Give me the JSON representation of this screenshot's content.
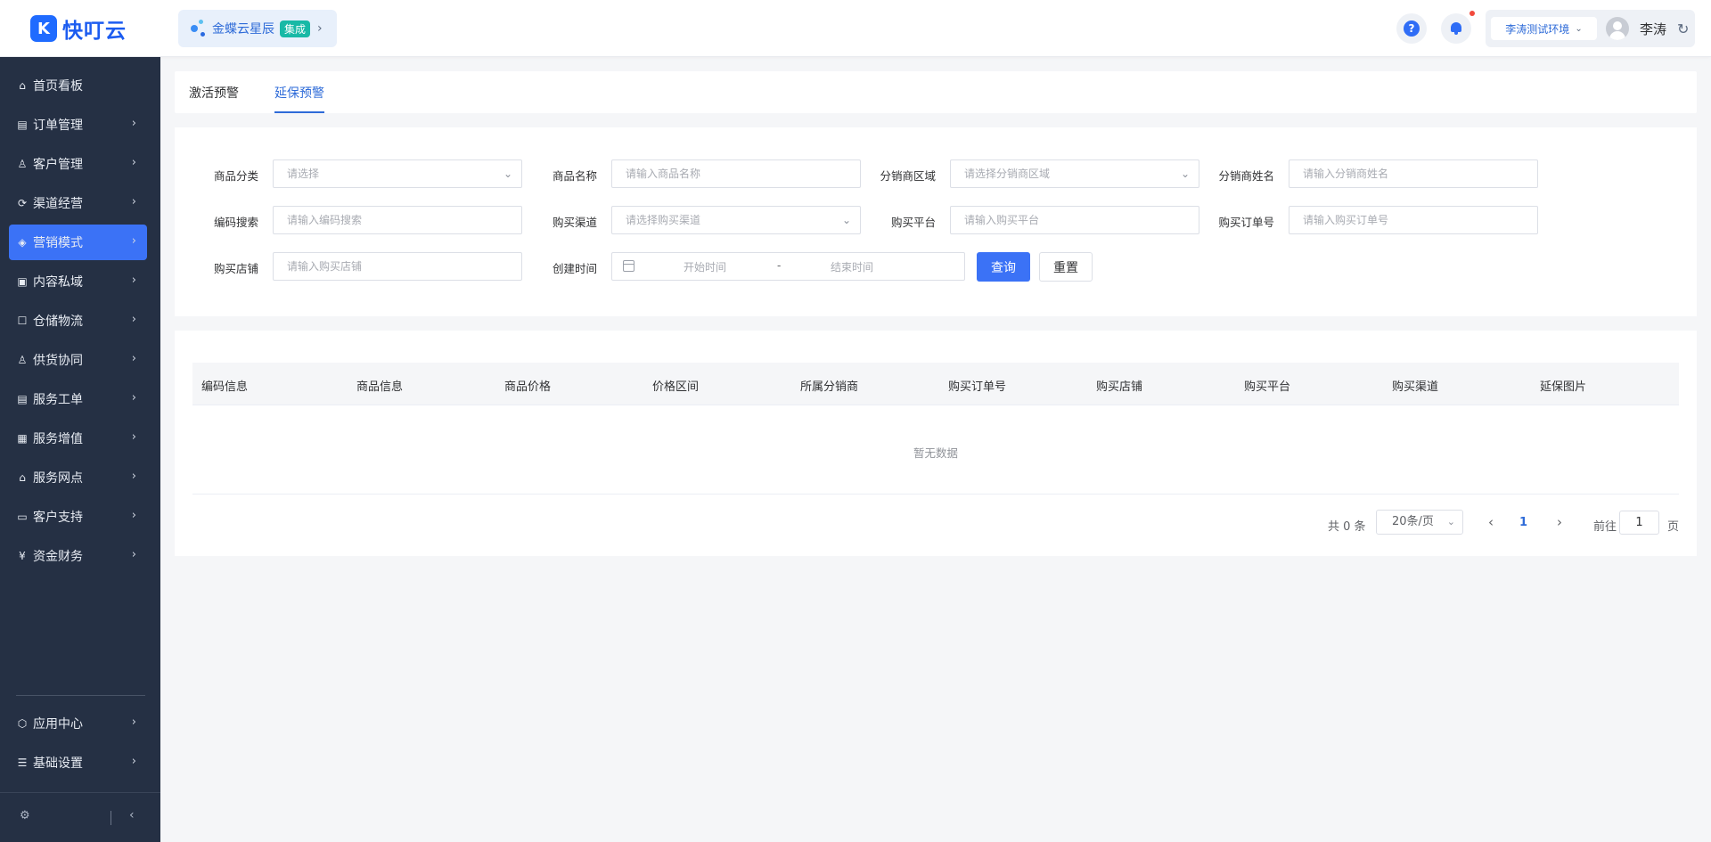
{
  "header": {
    "logo_text": "快叮云",
    "logo_mark": "K",
    "biz_name": "金蝶云星辰",
    "biz_badge": "集成",
    "help_label": "?",
    "env": "李涛测试环境",
    "user_name": "李涛"
  },
  "sidebar": {
    "items": [
      {
        "label": "首页看板",
        "icon": "⌂"
      },
      {
        "label": "订单管理",
        "icon": "▤"
      },
      {
        "label": "客户管理",
        "icon": "♙"
      },
      {
        "label": "渠道经营",
        "icon": "⟳"
      },
      {
        "label": "营销模式",
        "icon": "◈"
      },
      {
        "label": "内容私域",
        "icon": "▣"
      },
      {
        "label": "仓储物流",
        "icon": "☐"
      },
      {
        "label": "供货协同",
        "icon": "♙"
      },
      {
        "label": "服务工单",
        "icon": "▤"
      },
      {
        "label": "服务增值",
        "icon": "▦"
      },
      {
        "label": "服务网点",
        "icon": "⌂"
      },
      {
        "label": "客户支持",
        "icon": "▭"
      },
      {
        "label": "资金财务",
        "icon": "¥"
      }
    ],
    "bottom_items": [
      {
        "label": "应用中心",
        "icon": "⬡"
      },
      {
        "label": "基础设置",
        "icon": "☰"
      }
    ],
    "active_index": 4
  },
  "tabs": [
    {
      "label": "激活预警"
    },
    {
      "label": "延保预警"
    }
  ],
  "filters": {
    "category_label": "商品分类",
    "category_placeholder": "请选择",
    "product_label": "商品名称",
    "product_placeholder": "请输入商品名称",
    "region_label": "分销商区域",
    "region_placeholder": "请选择分销商区域",
    "dist_name_label": "分销商姓名",
    "dist_name_placeholder": "请输入分销商姓名",
    "code_label": "编码搜索",
    "code_placeholder": "请输入编码搜索",
    "channel_label": "购买渠道",
    "channel_placeholder": "请选择购买渠道",
    "platform_label": "购买平台",
    "platform_placeholder": "请输入购买平台",
    "order_label": "购买订单号",
    "order_placeholder": "请输入购买订单号",
    "shop_label": "购买店铺",
    "shop_placeholder": "请输入购买店铺",
    "created_label": "创建时间",
    "start_placeholder": "开始时间",
    "date_sep": "-",
    "end_placeholder": "结束时间",
    "query_label": "查询",
    "reset_label": "重置"
  },
  "table": {
    "columns": [
      "编码信息",
      "商品信息",
      "商品价格",
      "价格区间",
      "所属分销商",
      "购买订单号",
      "购买店铺",
      "购买平台",
      "购买渠道",
      "延保图片"
    ],
    "empty_text": "暂无数据"
  },
  "pagination": {
    "total": "共 0 条",
    "page_size": "20条/页",
    "current": "1",
    "goto_label": "前往",
    "goto_value": "1",
    "page_suffix": "页"
  }
}
